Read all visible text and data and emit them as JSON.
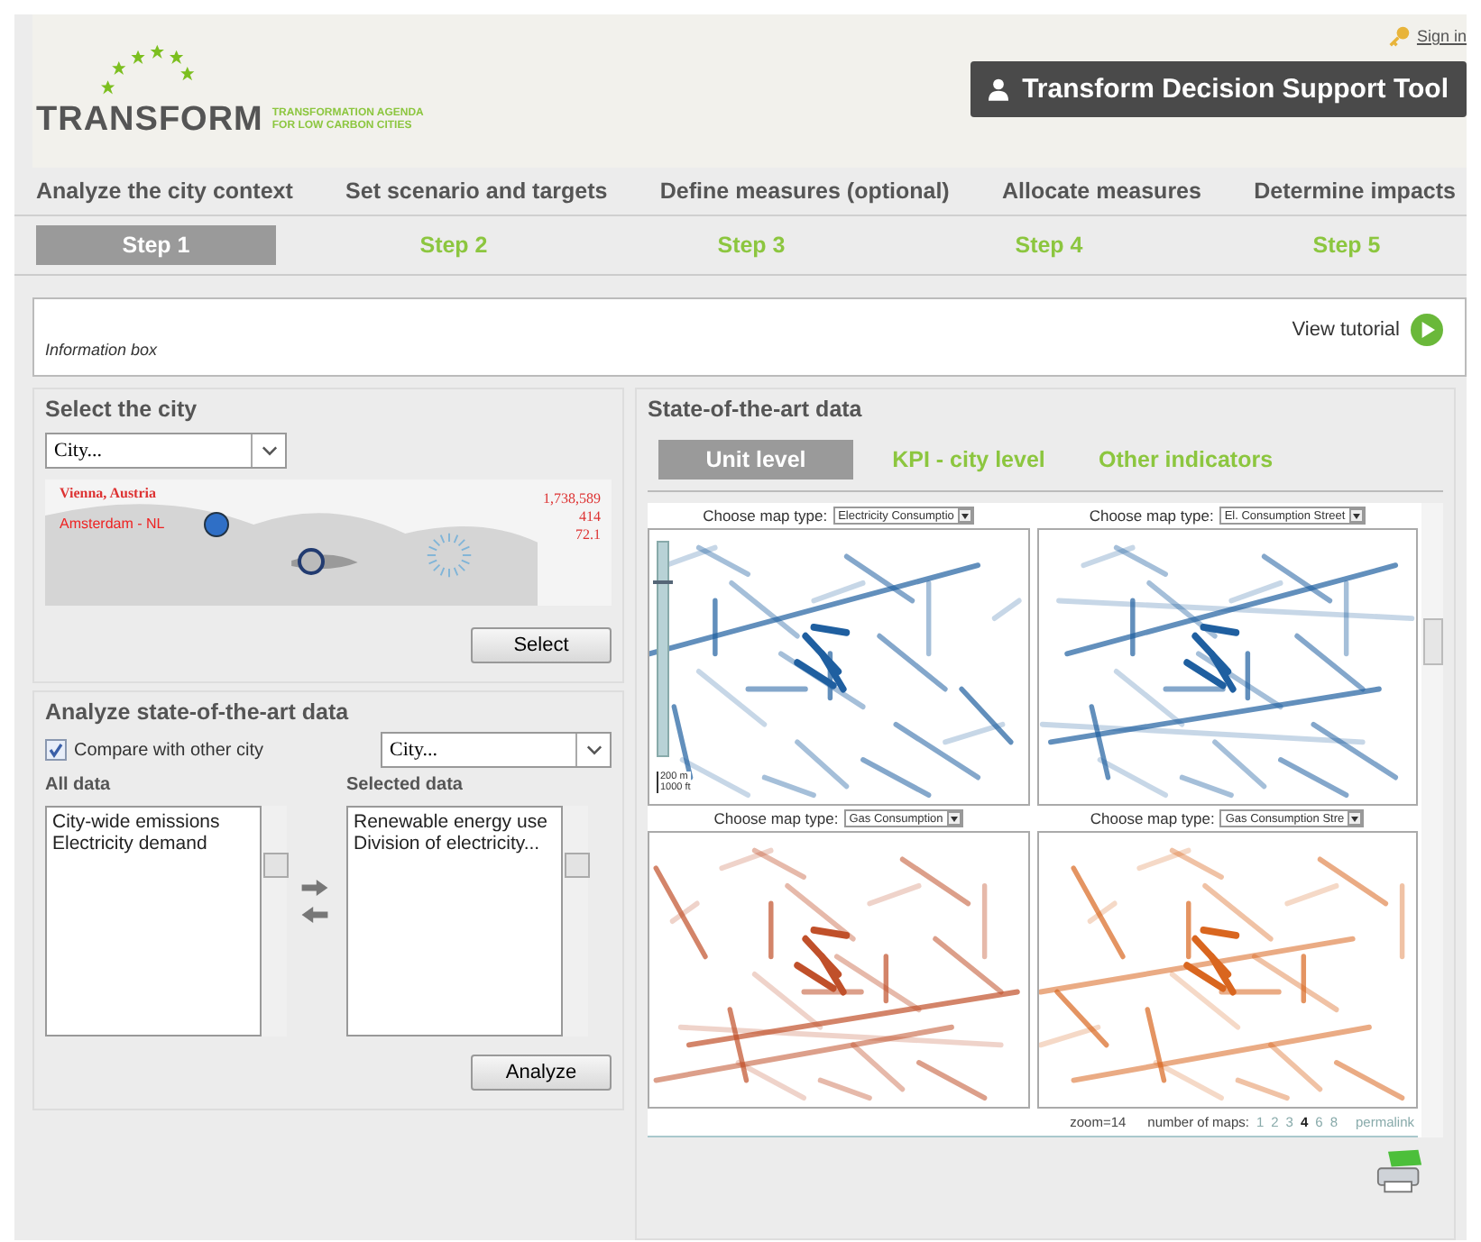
{
  "header": {
    "logo_text": "TRANSFORM",
    "logo_tagline": [
      "TRANSFORMATION AGENDA",
      "FOR LOW CARBON CITIES"
    ],
    "sign_in": "Sign in",
    "tool_title": "Transform Decision Support Tool"
  },
  "process": [
    {
      "label": "Analyze the city context",
      "step": "Step 1",
      "selected": true
    },
    {
      "label": "Set scenario and targets",
      "step": "Step 2",
      "selected": false
    },
    {
      "label": "Define measures (optional)",
      "step": "Step 3",
      "selected": false
    },
    {
      "label": "Allocate measures",
      "step": "Step 4",
      "selected": false
    },
    {
      "label": "Determine impacts",
      "step": "Step 5",
      "selected": false
    }
  ],
  "info_box": {
    "title": "Information box",
    "tutorial": "View tutorial"
  },
  "select_city": {
    "title": "Select the city",
    "city_select": "City...",
    "map": {
      "city_title": "Vienna, Austria",
      "compare_city": "Amsterdam - NL",
      "stats": [
        "1,738,589",
        "414",
        "72.1"
      ]
    },
    "button": "Select"
  },
  "analyze": {
    "title": "Analyze state-of-the-art data",
    "compare": {
      "label": "Compare with other city",
      "checked": true
    },
    "city_select": "City...",
    "all_data": {
      "label": "All data",
      "items": [
        "City-wide emissions",
        "Electricity demand"
      ]
    },
    "selected_data": {
      "label": "Selected data",
      "items": [
        "Renewable energy use",
        "Division of electricity..."
      ]
    },
    "button": "Analyze"
  },
  "state_of_the_art": {
    "title": "State-of-the-art data",
    "tabs": [
      {
        "label": "Unit level",
        "selected": true
      },
      {
        "label": "KPI - city level",
        "selected": false
      },
      {
        "label": "Other indicators",
        "selected": false
      }
    ],
    "maps": [
      {
        "label": "Choose map type:",
        "map_type": "Electricity Consumptio",
        "color": "#1f5fa0",
        "zoom_slider": {
          "level": 0.82
        },
        "scale": [
          "200 m",
          "1000 ft"
        ]
      },
      {
        "label": "Choose map type:",
        "map_type": "El. Consumption Street",
        "color": "#1f5fa0"
      },
      {
        "label": "Choose map type:",
        "map_type": "Gas Consumption",
        "color": "#c0502a"
      },
      {
        "label": "Choose map type:",
        "map_type": "Gas Consumption Stre",
        "color": "#d9661f"
      }
    ],
    "footer": {
      "zoom": "zoom=14",
      "maps_label": "number of maps:",
      "counts": [
        {
          "label": "1",
          "selected": false
        },
        {
          "label": "2",
          "selected": false
        },
        {
          "label": "3",
          "selected": false
        },
        {
          "label": "4",
          "selected": true
        },
        {
          "label": "6",
          "selected": false
        },
        {
          "label": "8",
          "selected": false
        }
      ],
      "permalink": "permalink"
    }
  }
}
